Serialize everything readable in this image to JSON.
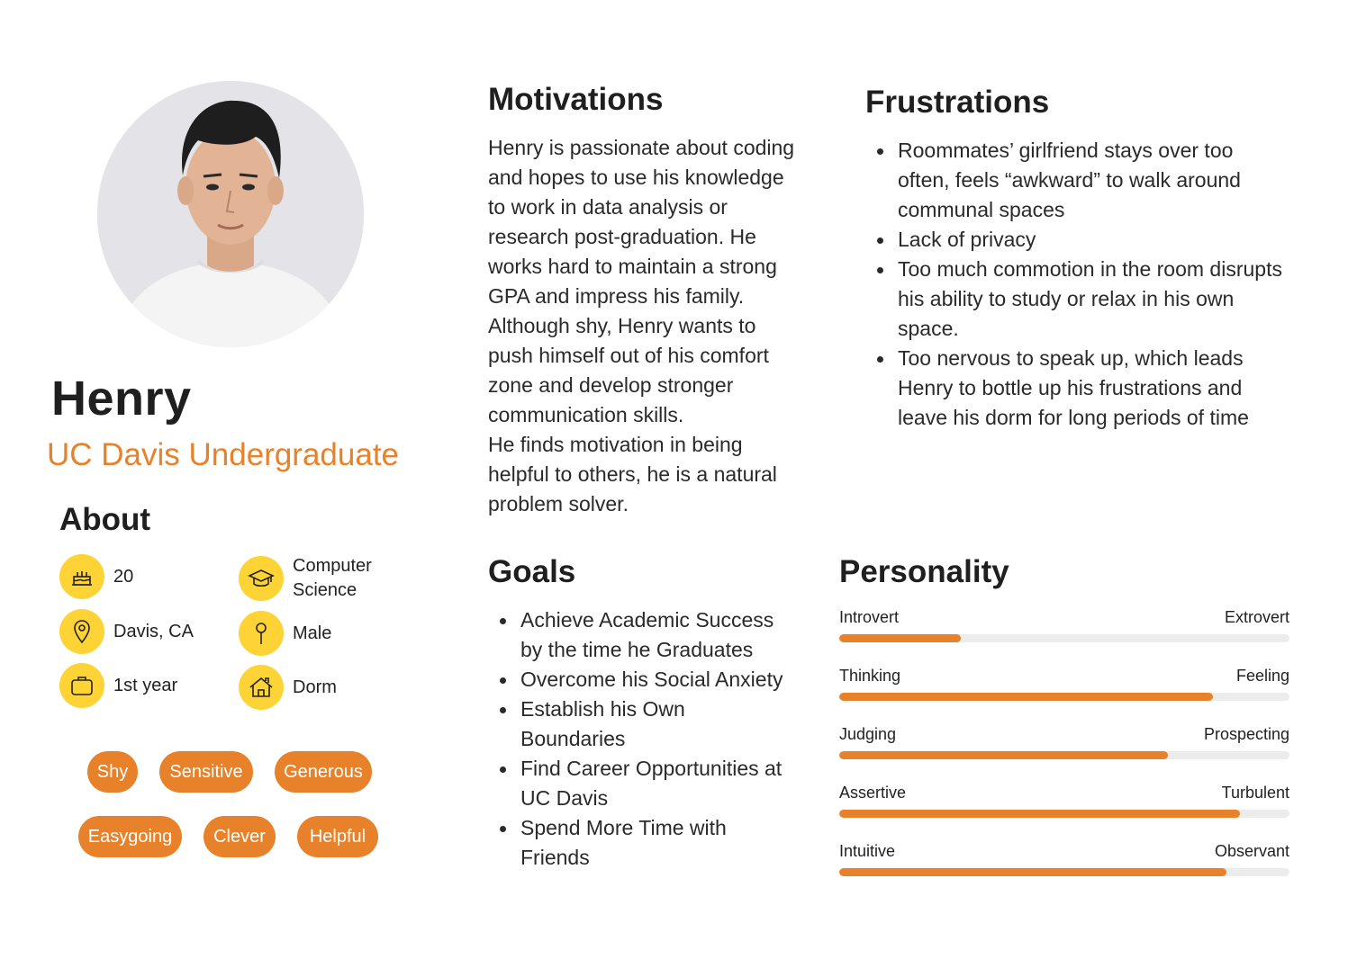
{
  "profile": {
    "name": "Henry",
    "subtitle": "UC Davis Undergraduate",
    "about_title": "About",
    "about": [
      {
        "icon": "cake-icon",
        "label": "20"
      },
      {
        "icon": "graduation-cap-icon",
        "label": "Computer Science"
      },
      {
        "icon": "location-pin-icon",
        "label": "Davis, CA"
      },
      {
        "icon": "gender-icon",
        "label": "Male"
      },
      {
        "icon": "briefcase-icon",
        "label": "1st year"
      },
      {
        "icon": "home-icon",
        "label": "Dorm"
      }
    ],
    "traits": [
      "Shy",
      "Sensitive",
      "Generous",
      "Easygoing",
      "Clever",
      "Helpful"
    ]
  },
  "motivations": {
    "title": "Motivations",
    "lines": [
      "Henry is passionate about coding",
      "and hopes to use his knowledge",
      "to work in data analysis or",
      "research post-graduation. He",
      "works hard to maintain a strong",
      "GPA and impress his family.",
      "Although shy, Henry wants to",
      "push himself out of his comfort",
      "zone and develop stronger",
      "communication skills.",
      "He finds motivation in being",
      "helpful to others, he is a natural",
      "problem solver."
    ]
  },
  "frustrations": {
    "title": "Frustrations",
    "items": [
      "Roommates’ girlfriend stays over too often, feels “awkward” to walk around communal spaces",
      "Lack of privacy",
      "Too much commotion in the room disrupts his ability to study or relax in his own space.",
      "Too nervous to speak up, which leads Henry to bottle up his frustrations and leave his dorm for long periods of time"
    ]
  },
  "goals": {
    "title": "Goals",
    "items": [
      "Achieve Academic Success by the time he Graduates",
      "Overcome his Social Anxiety",
      "Establish his Own Boundaries",
      "Find Career Opportunities at UC Davis",
      "Spend More Time with Friends"
    ]
  },
  "personality": {
    "title": "Personality",
    "scales": [
      {
        "left": "Introvert",
        "right": "Extrovert",
        "value": 0.27
      },
      {
        "left": "Thinking",
        "right": "Feeling",
        "value": 0.83
      },
      {
        "left": "Judging",
        "right": "Prospecting",
        "value": 0.73
      },
      {
        "left": "Assertive",
        "right": "Turbulent",
        "value": 0.89
      },
      {
        "left": "Intuitive",
        "right": "Observant",
        "value": 0.86
      }
    ]
  },
  "colors": {
    "accent": "#e8822a",
    "icon_bg": "#fdd335",
    "track": "#ececec"
  }
}
